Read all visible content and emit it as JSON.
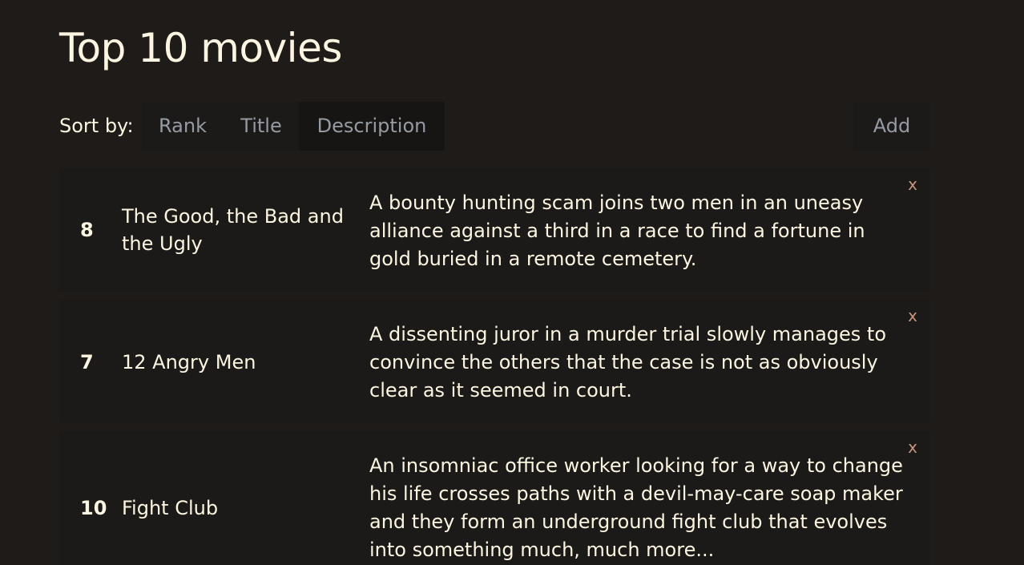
{
  "page": {
    "title": "Top 10 movies"
  },
  "sort": {
    "label": "Sort by:",
    "options": [
      "Rank",
      "Title",
      "Description"
    ],
    "add_label": "Add"
  },
  "movies": [
    {
      "rank": "8",
      "title": "The Good, the Bad and the Ugly",
      "description": "A bounty hunting scam joins two men in an uneasy alliance against a third in a race to find a fortune in gold buried in a remote cemetery.",
      "remove_label": "x"
    },
    {
      "rank": "7",
      "title": "12 Angry Men",
      "description": "A dissenting juror in a murder trial slowly manages to convince the others that the case is not as obviously clear as it seemed in court.",
      "remove_label": "x"
    },
    {
      "rank": "10",
      "title": "Fight Club",
      "description": "An insomniac office worker looking for a way to change his life crosses paths with a devil-may-care soap maker and they form an underground fight club that evolves into something much, much more...",
      "remove_label": "x"
    }
  ],
  "colors": {
    "background": "#1e1b19",
    "text": "#fbf5e1",
    "muted": "#969ba2",
    "remove": "#c9957a"
  }
}
